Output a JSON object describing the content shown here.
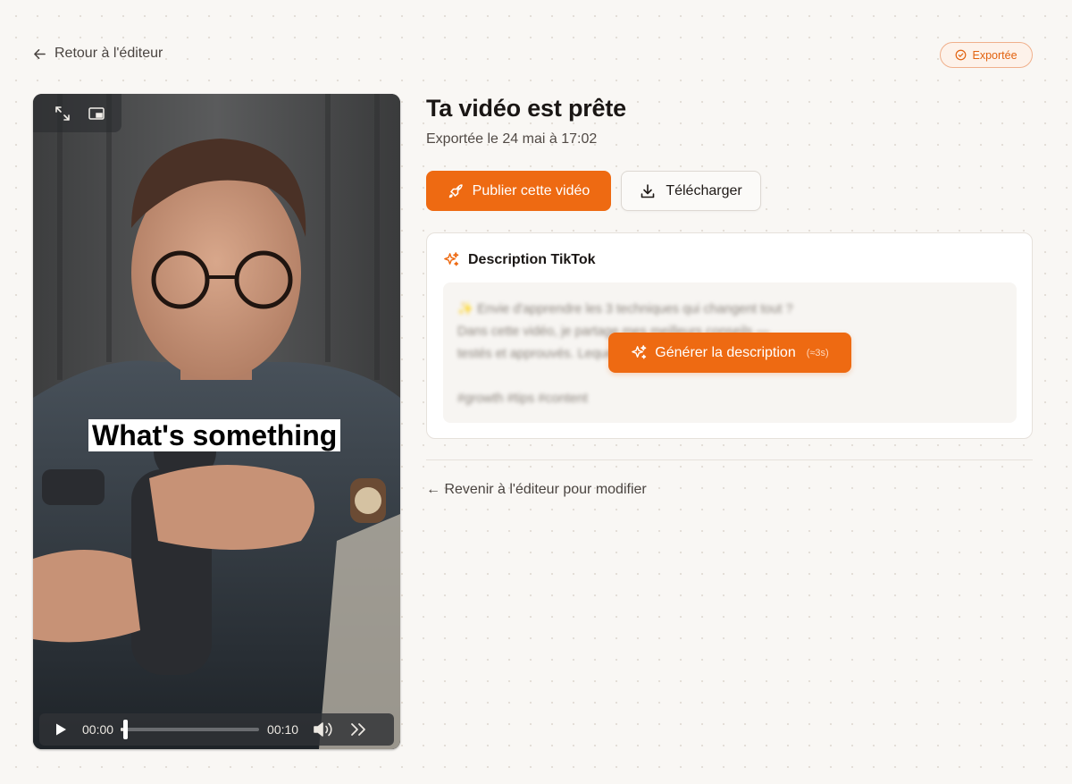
{
  "nav": {
    "back_label": "Retour à l'éditeur"
  },
  "status": {
    "label": "Exportée",
    "color": "#e2620f",
    "icon": "check-circle-icon"
  },
  "video": {
    "caption": "What's something",
    "current_time": "00:00",
    "duration": "00:10",
    "progress": 0.02,
    "top_controls": [
      "expand-icon",
      "picture-in-picture-icon"
    ],
    "bottom_controls": [
      "play-icon",
      "volume-icon",
      "skip-forward-icon"
    ]
  },
  "main": {
    "title": "Ta vidéo est prête",
    "subtitle": "Exportée le 24 mai à 17:02",
    "publish_label": "Publier cette vidéo",
    "download_label": "Télécharger",
    "accent_color": "#ee6a12"
  },
  "description": {
    "heading": "Description TikTok",
    "blurred_text": "✨ Envie d'apprendre les 3 techniques qui changent tout ?\nDans cette vidéo, je partage mes meilleurs conseils —\ntestés et approuvés. Lequel tu testes en premier ?\n\n#growth #tips #content",
    "generate_label": "Générer la description",
    "generate_hint": "(≈3s)"
  },
  "footer": {
    "edit_link": "← Revenir à l'éditeur pour modifier"
  }
}
